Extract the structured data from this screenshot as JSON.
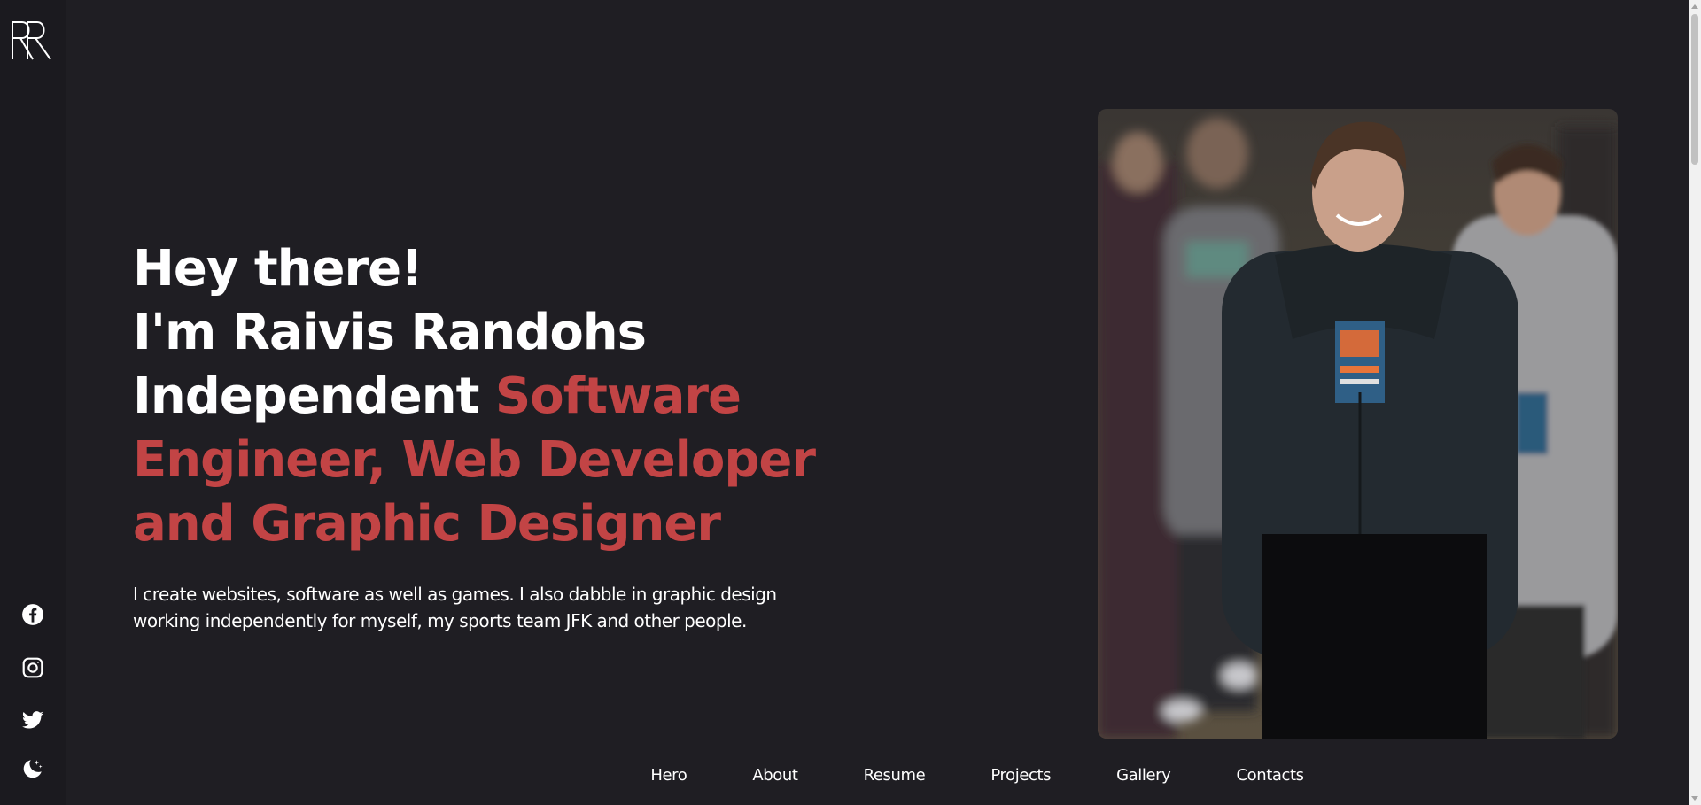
{
  "brand": {
    "logo_text": "RR",
    "accent_color": "#c24445",
    "background_color": "#1f1e23",
    "sidebar_color": "#1b1a1f"
  },
  "sidebar": {
    "social": [
      {
        "icon": "facebook-icon"
      },
      {
        "icon": "instagram-icon"
      },
      {
        "icon": "twitter-icon"
      },
      {
        "icon": "moon-stars-icon"
      }
    ]
  },
  "hero": {
    "line1": "Hey there!",
    "line2": "I'm Raivis Randohs",
    "line3_prefix": "Independent ",
    "line3_accent": "Software",
    "line4_accent": "Engineer, Web Developer",
    "line5_accent": "and Graphic Designer",
    "intro_line1": "I create websites, software as well as games. I also dabble in graphic design",
    "intro_line2": "working independently for myself, my sports team JFK and other people."
  },
  "nav": {
    "items": [
      "Hero",
      "About",
      "Resume",
      "Projects",
      "Gallery",
      "Contacts"
    ]
  }
}
